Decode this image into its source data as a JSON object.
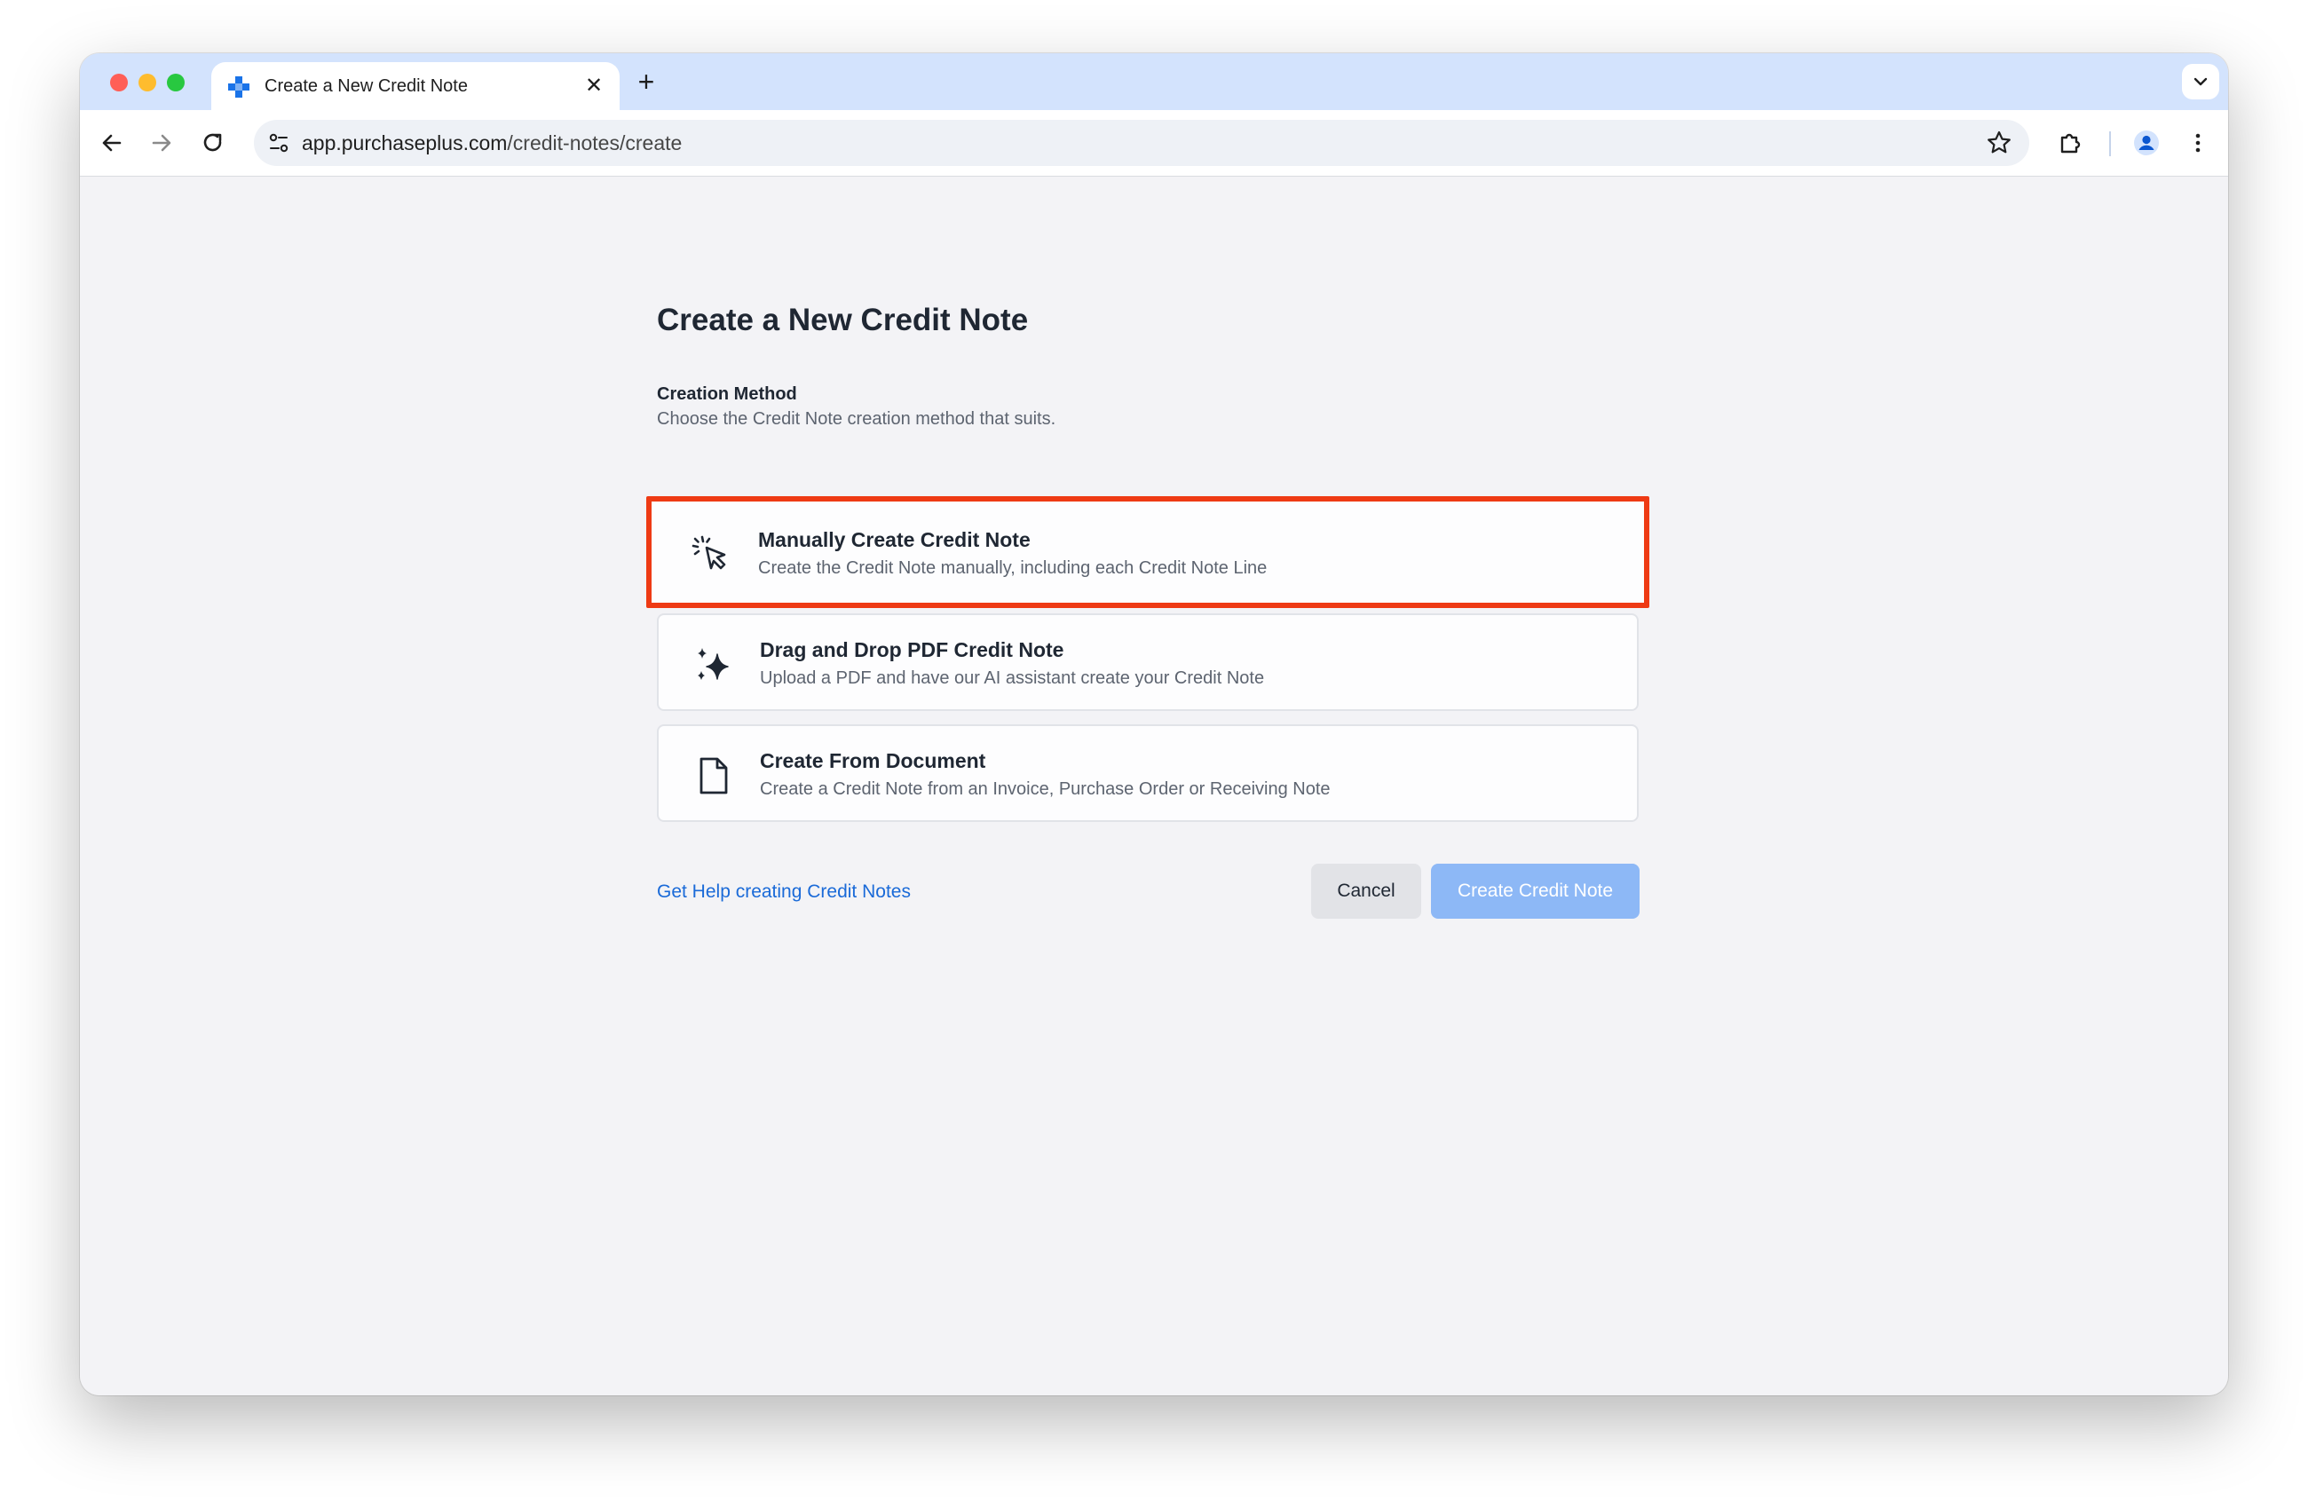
{
  "browser": {
    "tab": {
      "title": "Create a New Credit Note",
      "close_glyph": "✕",
      "favicon": "purchaseplus-logo"
    },
    "new_tab_glyph": "+",
    "address": {
      "host": "app.purchaseplus.com",
      "path": "/credit-notes/create"
    },
    "icons": [
      "back-icon",
      "forward-icon",
      "reload-icon",
      "site-settings-icon",
      "bookmark-star-icon",
      "extensions-icon",
      "profile-icon",
      "menu-icon",
      "tab-search-icon"
    ]
  },
  "page": {
    "title": "Create a New Credit Note",
    "section_label": "Creation Method",
    "section_help": "Choose the Credit Note creation method that suits.",
    "options": [
      {
        "title": "Manually Create Credit Note",
        "description": "Create the Credit Note manually, including each Credit Note Line",
        "icon": "cursor-click-icon",
        "highlighted": true
      },
      {
        "title": "Drag and Drop PDF Credit Note",
        "description": "Upload a PDF and have our AI assistant create your Credit Note",
        "icon": "sparkles-icon",
        "highlighted": false
      },
      {
        "title": "Create From Document",
        "description": "Create a Credit Note from an Invoice, Purchase Order or Receiving Note",
        "icon": "document-icon",
        "highlighted": false
      }
    ],
    "help_link": "Get Help creating Credit Notes",
    "cancel_label": "Cancel",
    "submit_label": "Create Credit Note"
  },
  "colors": {
    "highlight_border": "#ee3a14",
    "link": "#1a6ad8",
    "primary_disabled": "#8db8f6",
    "tab_strip": "#d3e3fd"
  }
}
